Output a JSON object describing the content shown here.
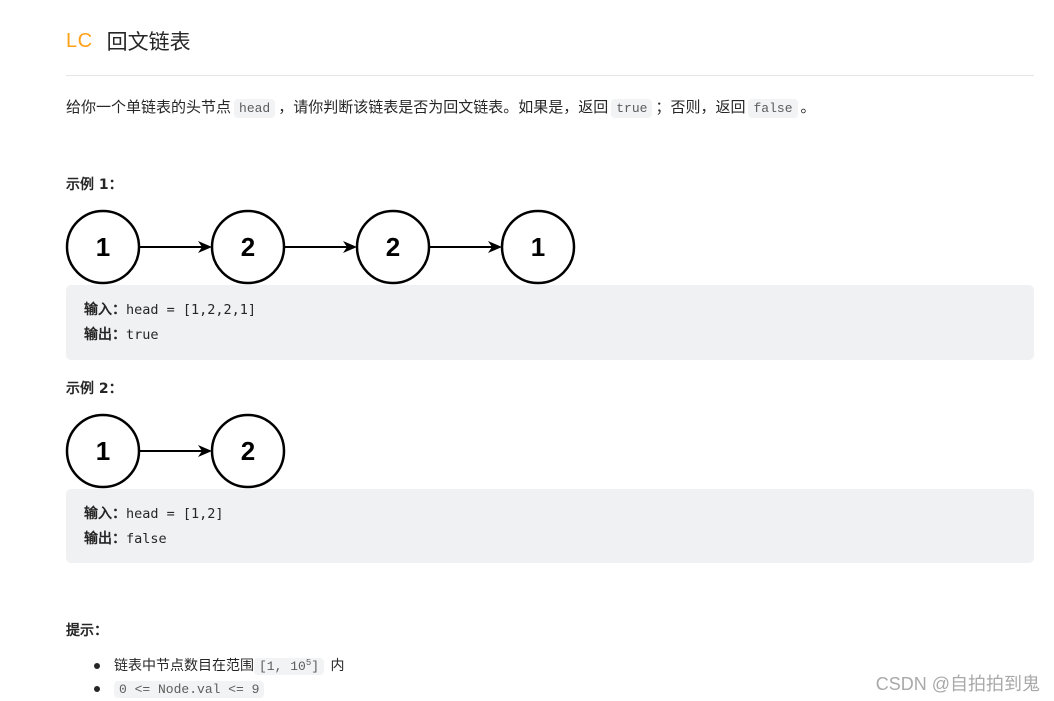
{
  "header": {
    "badge": "LC",
    "title": "回文链表"
  },
  "description": {
    "part1": "给你一个单链表的头节点",
    "code1": "head",
    "part2": "，请你判断该链表是否为回文链表。如果是，返回",
    "code2": "true",
    "part3": "；否则，返回",
    "code3": "false",
    "part4": "。"
  },
  "examples": [
    {
      "title": "示例 1：",
      "nodes": [
        "1",
        "2",
        "2",
        "1"
      ],
      "input_label": "输入：",
      "input_value": "head = [1,2,2,1]",
      "output_label": "输出：",
      "output_value": "true"
    },
    {
      "title": "示例 2：",
      "nodes": [
        "1",
        "2"
      ],
      "input_label": "输入：",
      "input_value": "head = [1,2]",
      "output_label": "输出：",
      "output_value": "false"
    }
  ],
  "hints": {
    "title": "提示：",
    "items": [
      {
        "text": "链表中节点数目在范围",
        "code": "[1, 10",
        "code_sup": "5",
        "code_end": "]",
        "suffix": " 内"
      },
      {
        "code": "0 <= Node.val <= 9"
      }
    ]
  },
  "watermark": "CSDN @自拍拍到鬼"
}
